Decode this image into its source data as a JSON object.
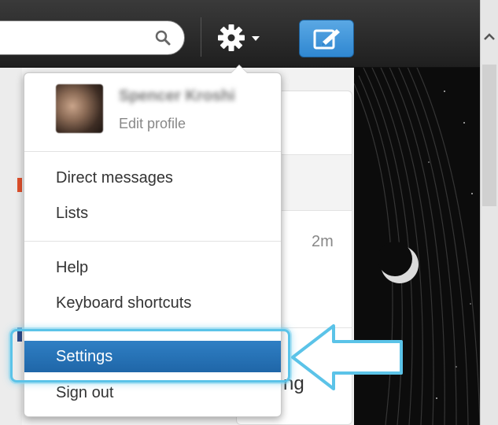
{
  "search": {
    "value": "",
    "placeholder": ""
  },
  "icons": {
    "search": "search-icon",
    "gear": "gear-icon",
    "compose": "compose-tweet-icon",
    "caret": "chevron-down-icon",
    "scroll_up": "chevron-up-icon"
  },
  "menu": {
    "profile": {
      "name": "Spencer Kroshi",
      "edit_label": "Edit profile"
    },
    "items": [
      {
        "label": "Direct messages"
      },
      {
        "label": "Lists"
      },
      {
        "label": "Help"
      },
      {
        "label": "Keyboard shortcuts"
      },
      {
        "label": "Settings",
        "selected": true
      },
      {
        "label": "Sign out"
      }
    ]
  },
  "feed": {
    "timestamp": "2m",
    "partial_text": "ng"
  },
  "colors": {
    "topbar": "#2b2b2b",
    "accent": "#2f87d1",
    "highlight": "#5bc3e8",
    "selected_item": "#2a76ba"
  }
}
